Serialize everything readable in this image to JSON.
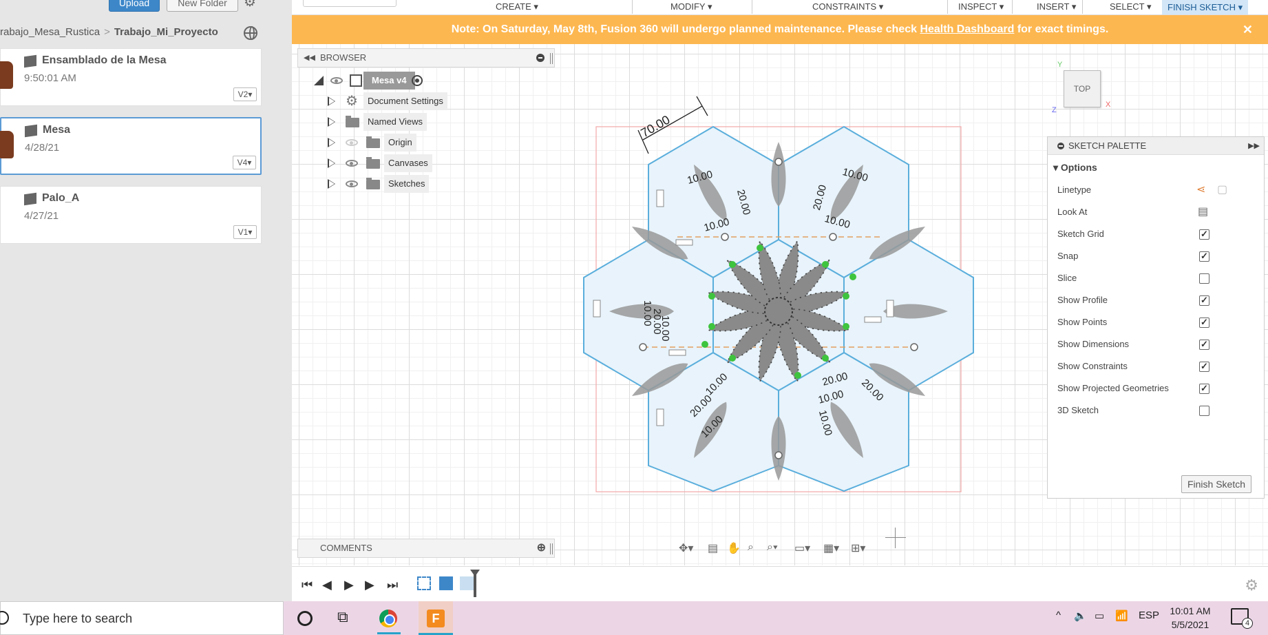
{
  "data_panel": {
    "upload_label": "Upload",
    "new_folder_label": "New Folder",
    "breadcrumb": {
      "parent": "rabajo_Mesa_Rustica",
      "current": "Trabajo_Mi_Proyecto"
    },
    "files": [
      {
        "name": "Ensamblado de la Mesa",
        "date": "9:50:01 AM",
        "version": "V2"
      },
      {
        "name": "Mesa",
        "date": "4/28/21",
        "version": "V4"
      },
      {
        "name": "Palo_A",
        "date": "4/27/21",
        "version": "V1"
      }
    ]
  },
  "toolbar": {
    "items": [
      "CREATE",
      "MODIFY",
      "CONSTRAINTS",
      "INSPECT",
      "INSERT",
      "SELECT",
      "FINISH SKETCH"
    ]
  },
  "banner": {
    "text_before": "Note: On Saturday, May 8th, Fusion 360 will undergo planned maintenance. Please check ",
    "link": "Health Dashboard",
    "text_after": " for exact timings.",
    "close": "✕"
  },
  "browser": {
    "title": "BROWSER",
    "root": "Mesa v4",
    "nodes": [
      "Document Settings",
      "Named Views",
      "Origin",
      "Canvases",
      "Sketches"
    ]
  },
  "comments": {
    "title": "COMMENTS"
  },
  "viewcube": {
    "face": "TOP",
    "x": "X",
    "y": "Y",
    "z": "Z"
  },
  "sketch": {
    "dim_top": "70.00",
    "dims": [
      "10.00",
      "20.00",
      "10.00",
      "20.00",
      "10.00",
      "10.00",
      "10.00",
      "20.00",
      "10.00",
      "20.00",
      "10.00",
      "20.00",
      "10.00",
      "10.00",
      "20.00",
      "10.00"
    ]
  },
  "palette": {
    "title": "SKETCH PALETTE",
    "section": "Options",
    "options": [
      {
        "label": "Linetype",
        "kind": "icons"
      },
      {
        "label": "Look At",
        "kind": "icon"
      },
      {
        "label": "Sketch Grid",
        "checked": true
      },
      {
        "label": "Snap",
        "checked": true
      },
      {
        "label": "Slice",
        "checked": false
      },
      {
        "label": "Show Profile",
        "checked": true
      },
      {
        "label": "Show Points",
        "checked": true
      },
      {
        "label": "Show Dimensions",
        "checked": true
      },
      {
        "label": "Show Constraints",
        "checked": true
      },
      {
        "label": "Show Projected Geometries",
        "checked": true
      },
      {
        "label": "3D Sketch",
        "checked": false
      }
    ],
    "finish_label": "Finish Sketch"
  },
  "taskbar": {
    "search_placeholder": "Type here to search",
    "language": "ESP",
    "time": "10:01 AM",
    "date": "5/5/2021",
    "notifications": "4"
  },
  "colors": {
    "banner": "#fdb750",
    "accent": "#3d87c9",
    "sketch_line": "#5aaedc",
    "profile_fill": "#e8f3fb",
    "leaf_fill": "#9a9a9a",
    "point_green": "#3ec43e"
  }
}
